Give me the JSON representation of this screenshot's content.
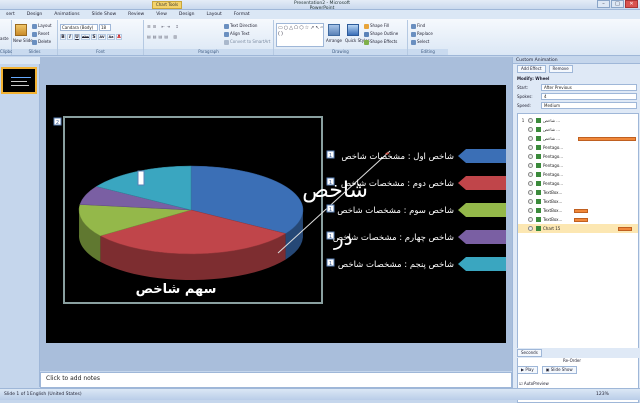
{
  "titlebar": {
    "context_tab": "Chart Tools",
    "title": "Presentation2 - Microsoft PowerPoint",
    "minimize": "–",
    "maximize": "□",
    "close": "✕"
  },
  "tabs": [
    "sert",
    "Design",
    "Animations",
    "Slide Show",
    "Review",
    "View",
    "Design",
    "Layout",
    "Format"
  ],
  "ribbon": {
    "clipboard": {
      "label": "Clipboard",
      "paste": "aste"
    },
    "slides": {
      "label": "Slides",
      "new_slide": "New Slide",
      "layout": "Layout",
      "reset": "Reset",
      "delete": "Delete"
    },
    "font": {
      "label": "Font",
      "font_name": "Candara (Body)",
      "font_size": "18",
      "bold": "B",
      "italic": "I",
      "underline": "U",
      "strike": "abc",
      "shadow": "S",
      "spacing": "AV",
      "case": "Aa",
      "color": "A"
    },
    "paragraph": {
      "label": "Paragraph",
      "text_direction": "Text Direction",
      "align_text": "Align Text",
      "smartart": "Convert to SmartArt"
    },
    "drawing": {
      "label": "Drawing",
      "arrange": "Arrange",
      "quick_styles": "Quick Styles",
      "shape_fill": "Shape Fill",
      "shape_outline": "Shape Outline",
      "shape_effects": "Shape Effects"
    },
    "editing": {
      "label": "Editing",
      "find": "Find",
      "replace": "Replace",
      "select": "Select"
    }
  },
  "slide": {
    "chart_title": "سهم شاخص",
    "big_text_1": "شاخص",
    "big_text_2": "در",
    "tag_num": "2",
    "legend_tags": [
      "1",
      "1",
      "1",
      "1",
      "1"
    ]
  },
  "chart_data": {
    "type": "pie",
    "title": "سهم شاخص",
    "categories": [
      "شاخص اول",
      "شاخص دوم",
      "شاخص سوم",
      "شاخص چهارم",
      "شاخص پنجم"
    ],
    "values": [
      34,
      31,
      12,
      7,
      16
    ],
    "colors": [
      "#3b6fb6",
      "#c0454a",
      "#94b84a",
      "#7a5fa3",
      "#3aa6c0"
    ],
    "legend": [
      "شاخص اول : مشخصات شاخص",
      "شاخص دوم : مشخصات شاخص",
      "شاخص سوم : مشخصات شاخص",
      "شاخص چهارم : مشخصات شاخص",
      "شاخص پنجم : مشخصات شاخص"
    ]
  },
  "notes": {
    "placeholder": "Click to add notes"
  },
  "custom_animation": {
    "header": "Custom Animation",
    "add_effect": "Add Effect",
    "remove": "Remove",
    "modify": "Modify: Wheel",
    "start_label": "Start:",
    "start_value": "After Previous",
    "spokes_label": "Spokes:",
    "spokes_value": "4",
    "speed_label": "Speed:",
    "speed_value": "Medium",
    "items": [
      {
        "num": "1",
        "text": "شاخص ...",
        "bar": false
      },
      {
        "num": "",
        "text": "شاخص ...",
        "bar": false
      },
      {
        "num": "",
        "text": "شاخص ...",
        "bar": true
      },
      {
        "num": "",
        "text": "Pentago...",
        "bar": false
      },
      {
        "num": "",
        "text": "Pentago...",
        "bar": false
      },
      {
        "num": "",
        "text": "Pentago...",
        "bar": false
      },
      {
        "num": "",
        "text": "Pentago...",
        "bar": false
      },
      {
        "num": "",
        "text": "Pentago...",
        "bar": false
      },
      {
        "num": "",
        "text": "TextBox...",
        "bar": false
      },
      {
        "num": "",
        "text": "TextBox...",
        "bar": false
      },
      {
        "num": "",
        "text": "TextBox...",
        "bar": true
      },
      {
        "num": "",
        "text": "TextBox...",
        "bar": true
      },
      {
        "num": "",
        "text": "Chart 15",
        "bar": true
      }
    ],
    "timeline_unit": "Seconds",
    "reorder": "Re-Order",
    "play": "Play",
    "slide_show": "Slide Show",
    "autopreview": "AutoPreview"
  },
  "status": {
    "slide": "Slide 1 of 1",
    "language": "English (United States)",
    "zoom": "123%"
  }
}
